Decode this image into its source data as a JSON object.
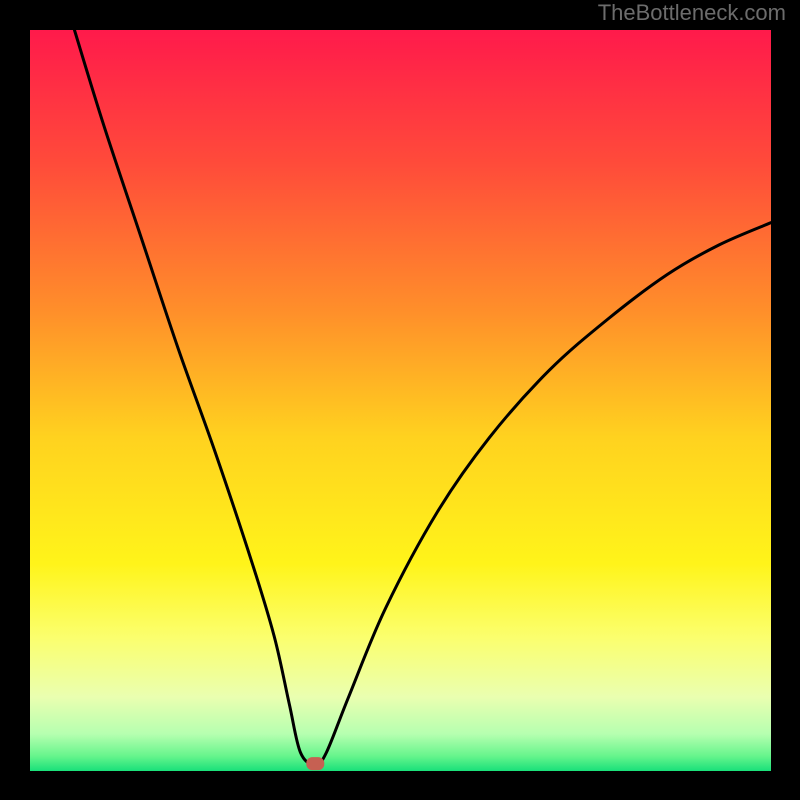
{
  "watermark": "TheBottleneck.com",
  "chart_data": {
    "type": "line",
    "title": "",
    "xlabel": "",
    "ylabel": "",
    "xlim": [
      0,
      100
    ],
    "ylim": [
      0,
      100
    ],
    "grid": false,
    "legend": false,
    "description": "V-shaped curve on a vertical rainbow gradient (red top → yellow middle → green bottom). Left branch is steep, right branch is shallower. Minimum near x≈38, y≈0 where a small rounded marker sits. Left branch reaches y=100 at x≈6; right branch reaches y≈74 at x=100.",
    "series": [
      {
        "name": "curve",
        "x": [
          6,
          10,
          15,
          20,
          25,
          30,
          33,
          35,
          36.5,
          38.5,
          40,
          43,
          48,
          55,
          62,
          70,
          78,
          86,
          93,
          100
        ],
        "y": [
          100,
          87,
          72,
          57,
          43,
          28,
          18,
          9,
          2.5,
          0.8,
          2.5,
          10,
          22,
          35,
          45,
          54,
          61,
          67,
          71,
          74
        ]
      }
    ],
    "marker": {
      "x": 38.5,
      "y": 0.8
    },
    "gradient_stops": [
      {
        "offset": 0.0,
        "color": "#ff1a4b"
      },
      {
        "offset": 0.18,
        "color": "#ff4b3a"
      },
      {
        "offset": 0.38,
        "color": "#ff8f2a"
      },
      {
        "offset": 0.55,
        "color": "#ffd21f"
      },
      {
        "offset": 0.72,
        "color": "#fff41a"
      },
      {
        "offset": 0.82,
        "color": "#fbff6e"
      },
      {
        "offset": 0.9,
        "color": "#eaffb0"
      },
      {
        "offset": 0.95,
        "color": "#b6ffb0"
      },
      {
        "offset": 0.98,
        "color": "#66f58c"
      },
      {
        "offset": 1.0,
        "color": "#19e07a"
      }
    ]
  }
}
